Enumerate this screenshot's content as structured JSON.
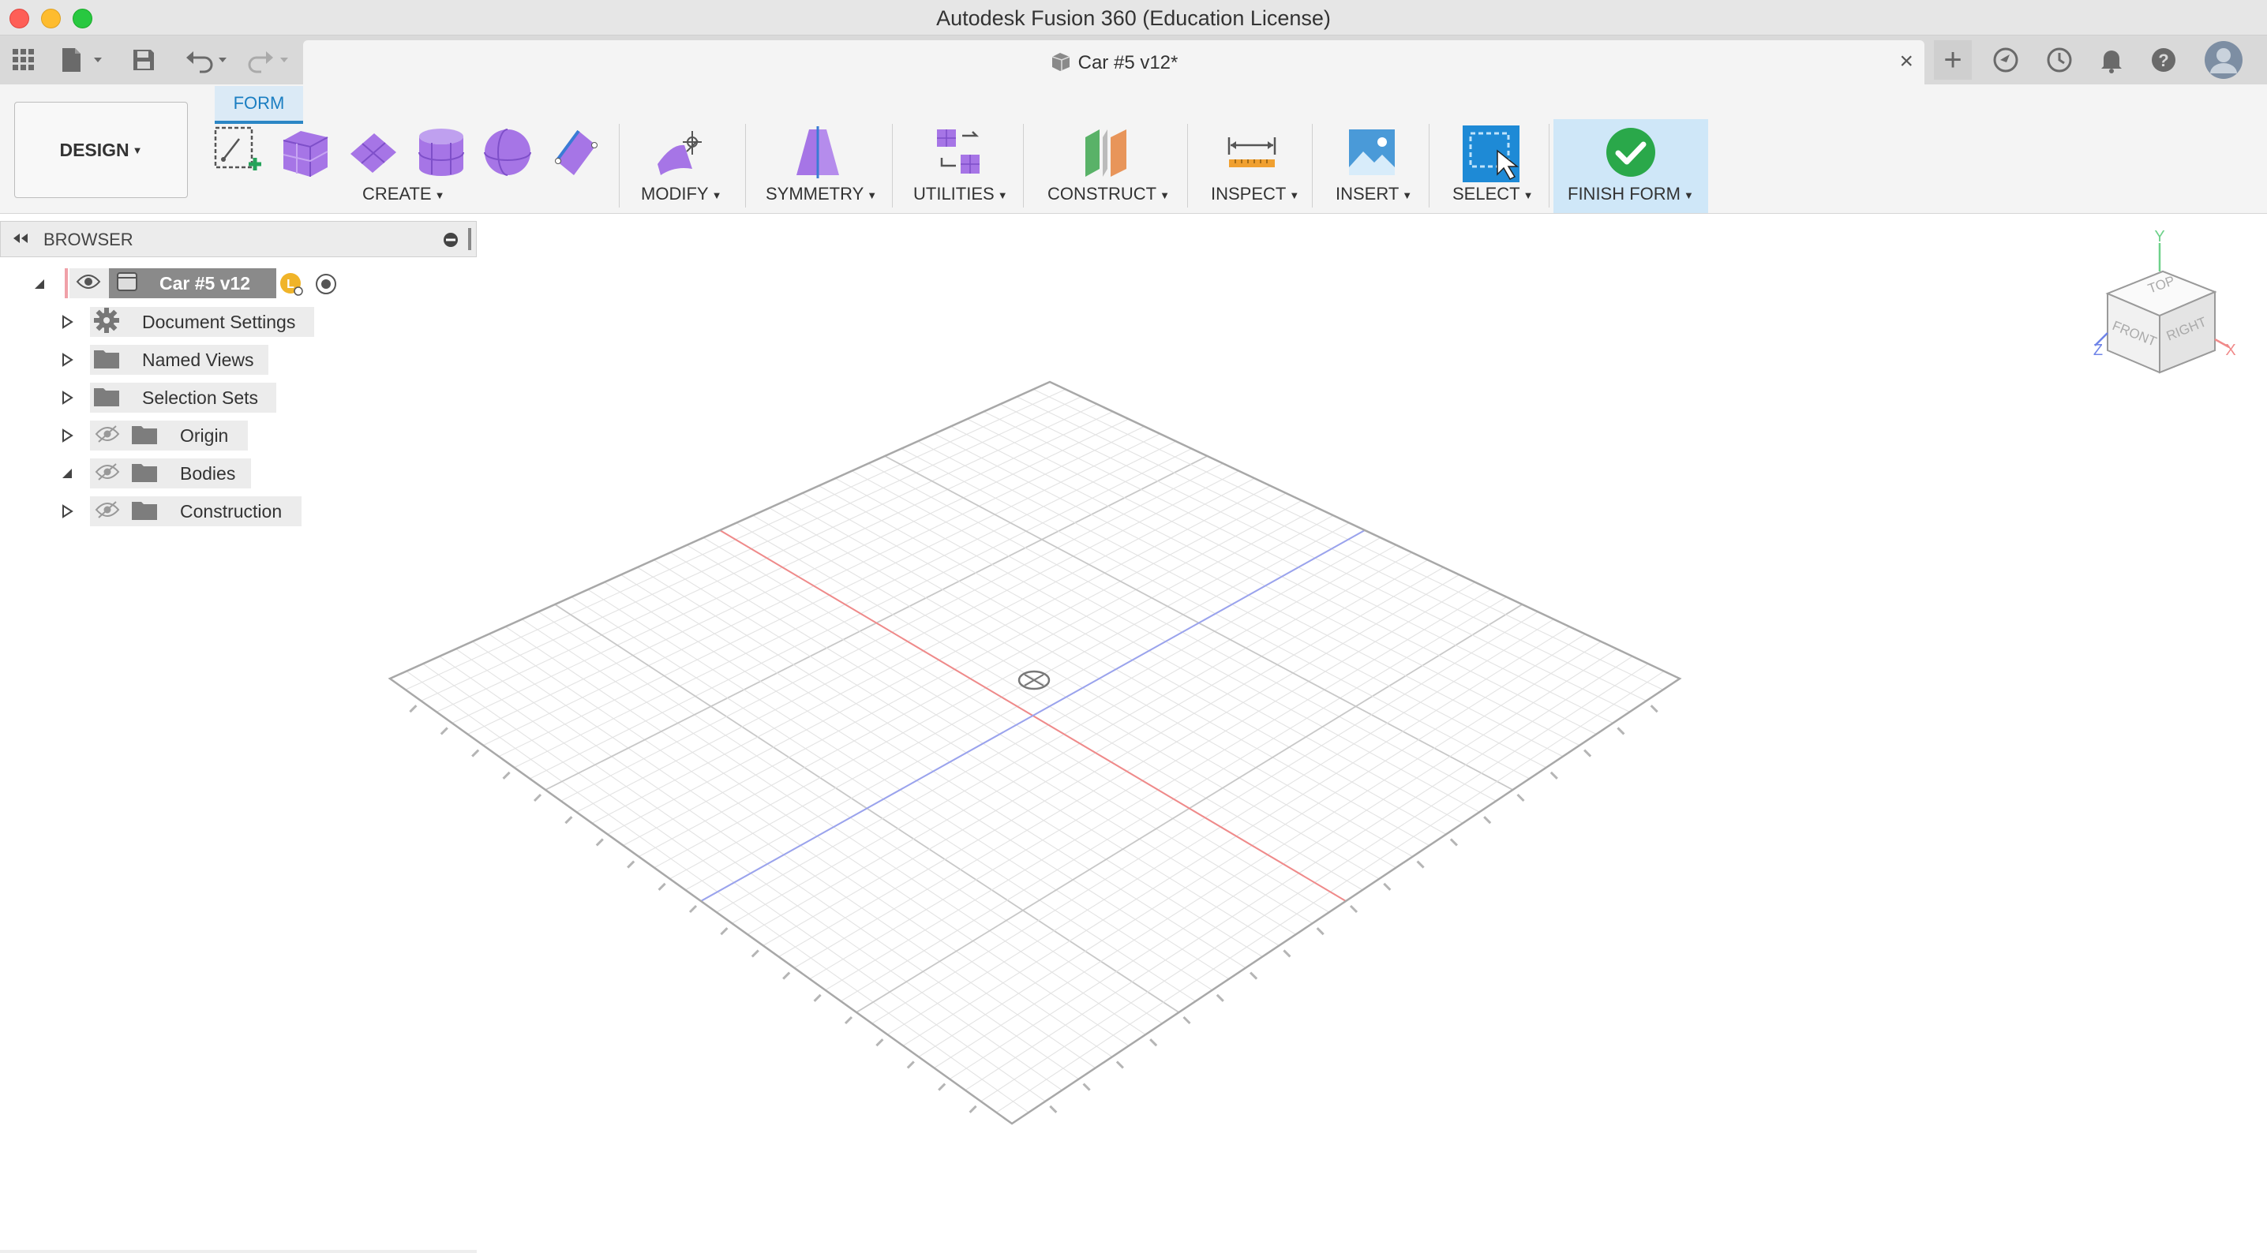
{
  "window": {
    "title": "Autodesk Fusion 360 (Education License)"
  },
  "tabbar": {
    "doc_tab_title": "Car #5 v12*",
    "close_symbol": "×",
    "new_tab_symbol": "+"
  },
  "ribbon": {
    "workspace_label": "DESIGN",
    "active_tab": "FORM",
    "groups": {
      "create": "CREATE",
      "modify": "MODIFY",
      "symmetry": "SYMMETRY",
      "utilities": "UTILITIES",
      "construct": "CONSTRUCT",
      "inspect": "INSPECT",
      "insert": "INSERT",
      "select": "SELECT",
      "finish": "FINISH FORM"
    }
  },
  "browser": {
    "title": "BROWSER",
    "root": "Car #5 v12",
    "items": [
      {
        "label": "Document Settings"
      },
      {
        "label": "Named Views"
      },
      {
        "label": "Selection Sets"
      },
      {
        "label": "Origin"
      },
      {
        "label": "Bodies"
      },
      {
        "label": "Construction"
      }
    ]
  },
  "viewcube": {
    "top": "TOP",
    "front": "FRONT",
    "right": "RIGHT",
    "axis_x": "X",
    "axis_y": "Y",
    "axis_z": "Z"
  },
  "colors": {
    "accent": "#2b86c5",
    "form_purple": "#a675e6",
    "x_axis": "#f08a8a",
    "z_axis": "#9aa3ee",
    "grid": "#e3e3e3",
    "grid_major": "#c8c8c8"
  }
}
